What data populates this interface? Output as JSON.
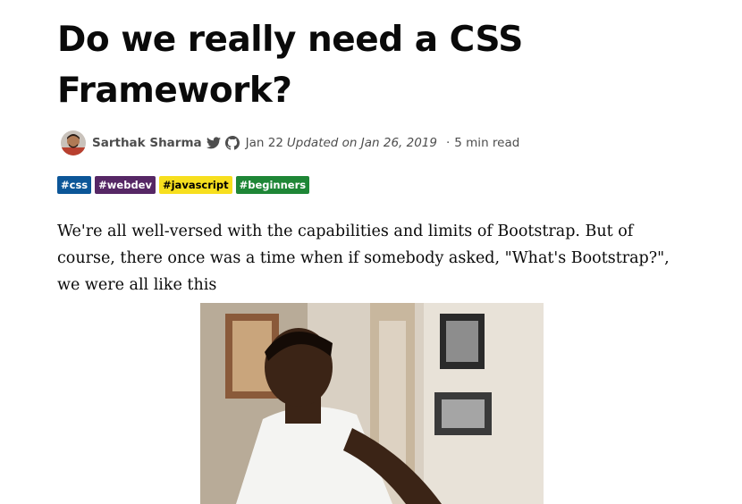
{
  "article": {
    "title": "Do we really need a CSS Framework?",
    "author": "Sarthak Sharma",
    "date": "Jan 22",
    "updated": "Updated on Jan 26, 2019",
    "separator": "·",
    "read_time": "5 min read",
    "tags": [
      {
        "label": "#css",
        "bg": "#0c5698",
        "color": "#ffffff"
      },
      {
        "label": "#webdev",
        "bg": "#562765",
        "color": "#ffffff"
      },
      {
        "label": "#javascript",
        "bg": "#f7df1e",
        "color": "#000000"
      },
      {
        "label": "#beginners",
        "bg": "#1e8636",
        "color": "#ffffff"
      }
    ],
    "body": "We're all well-versed with the capabilities and limits of Bootstrap. But of course, there once was a time when if somebody asked, \"What's Bootstrap?\", we were all like this"
  },
  "icons": {
    "twitter": "twitter-icon",
    "github": "github-icon"
  }
}
